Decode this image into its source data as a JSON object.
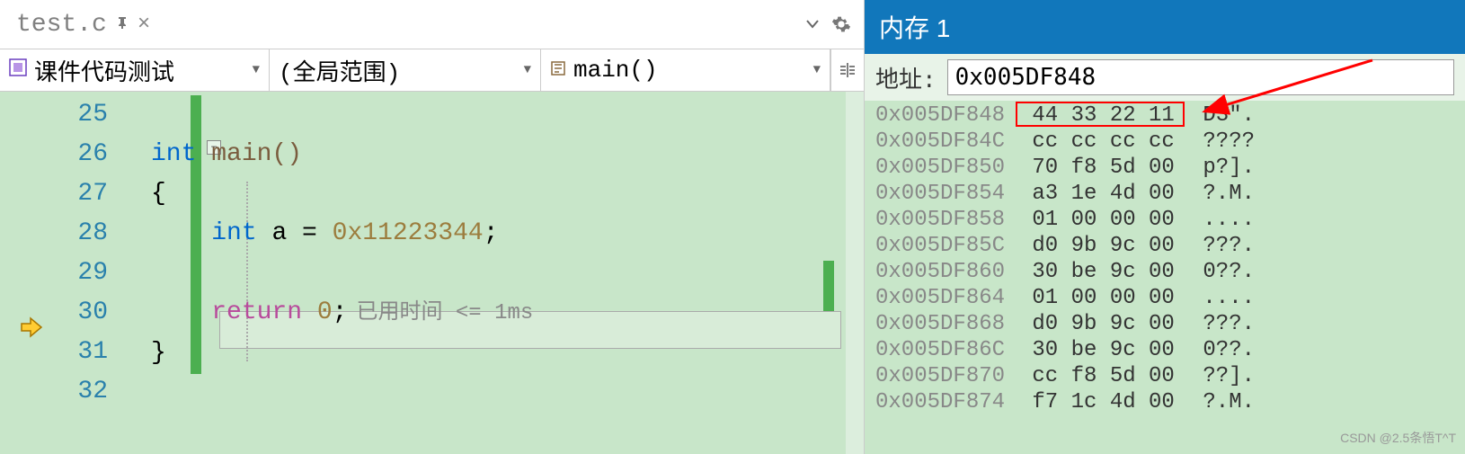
{
  "tab": {
    "filename": "test.c",
    "pin": "⬛",
    "close": "×"
  },
  "nav": {
    "scope": "课件代码测试",
    "class": "(全局范围)",
    "func": "main()"
  },
  "code": {
    "lines": [
      "25",
      "26",
      "27",
      "28",
      "29",
      "30",
      "31",
      "32"
    ],
    "line26_kw": "int",
    "line26_func": " main()",
    "line27": "{",
    "line28_indent": "    ",
    "line28_kw": "int",
    "line28_rest": " a = ",
    "line28_num": "0x11223344",
    "line28_semi": ";",
    "line30_indent": "    ",
    "line30_ret": "return",
    "line30_rest": " ",
    "line30_num": "0",
    "line30_semi": ";",
    "line30_hint": "已用时间 <= 1ms",
    "line31": "}"
  },
  "memory": {
    "title": "内存 1",
    "addr_label": "地址:",
    "addr_value": "0x005DF848",
    "rows": [
      {
        "addr": "0x005DF848",
        "hex": " 44 33 22 11",
        "ascii": " D3\"."
      },
      {
        "addr": "0x005DF84C",
        "hex": " cc cc cc cc",
        "ascii": " ????"
      },
      {
        "addr": "0x005DF850",
        "hex": " 70 f8 5d 00",
        "ascii": " p?]."
      },
      {
        "addr": "0x005DF854",
        "hex": " a3 1e 4d 00",
        "ascii": " ?.M."
      },
      {
        "addr": "0x005DF858",
        "hex": " 01 00 00 00",
        "ascii": " ...."
      },
      {
        "addr": "0x005DF85C",
        "hex": " d0 9b 9c 00",
        "ascii": " ???."
      },
      {
        "addr": "0x005DF860",
        "hex": " 30 be 9c 00",
        "ascii": " 0??."
      },
      {
        "addr": "0x005DF864",
        "hex": " 01 00 00 00",
        "ascii": " ...."
      },
      {
        "addr": "0x005DF868",
        "hex": " d0 9b 9c 00",
        "ascii": " ???."
      },
      {
        "addr": "0x005DF86C",
        "hex": " 30 be 9c 00",
        "ascii": " 0??."
      },
      {
        "addr": "0x005DF870",
        "hex": " cc f8 5d 00",
        "ascii": " ??]."
      },
      {
        "addr": "0x005DF874",
        "hex": " f7 1c 4d 00",
        "ascii": " ?.M."
      }
    ]
  },
  "watermark": "CSDN @2.5条悟T^T"
}
